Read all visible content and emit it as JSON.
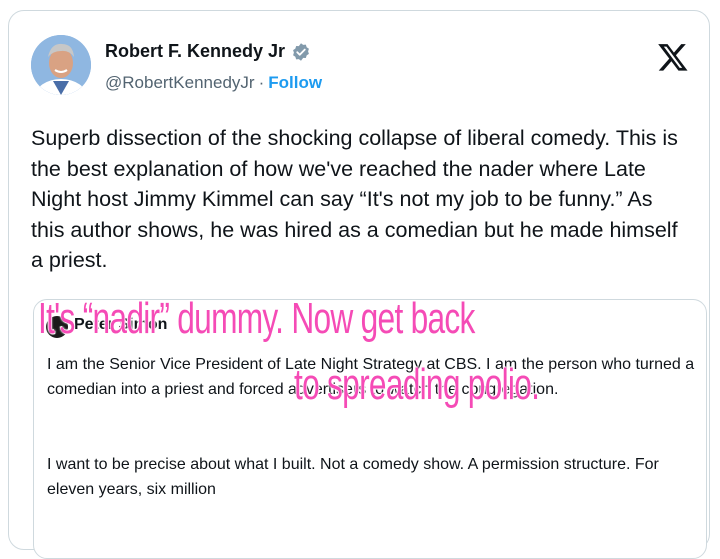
{
  "tweet": {
    "author_name": "Robert F. Kennedy Jr",
    "handle": "@RobertKennedyJr",
    "separator": "·",
    "follow_label": "Follow",
    "text": "Superb dissection of the shocking collapse of liberal comedy. This is the best explanation of how we've reached the nader where Late Night host Jimmy Kimmel can say “It's not my job to be funny.” As this author shows, he was hired as a comedian but he made himself a priest.",
    "icons": {
      "verified": "verified-badge-icon",
      "brand": "x-logo-icon"
    },
    "colors": {
      "link": "#1d9bf0",
      "handle": "#536471",
      "verified": "#829aab"
    }
  },
  "quote": {
    "author_partial": "Peter Simon",
    "paragraph_1": "I am the Senior Vice President of Late Night Strategy at CBS. I am the person who turned a comedian into a priest and forced advertisers to watch the congregation.",
    "paragraph_2": "I want to be precise about what I built. Not a comedy show. A permission structure. For eleven years, six million"
  },
  "overlay": {
    "line_1": "It's “nadir” dummy. Now get back",
    "line_2": "to spreading polio.",
    "color": "#f54bb6"
  }
}
